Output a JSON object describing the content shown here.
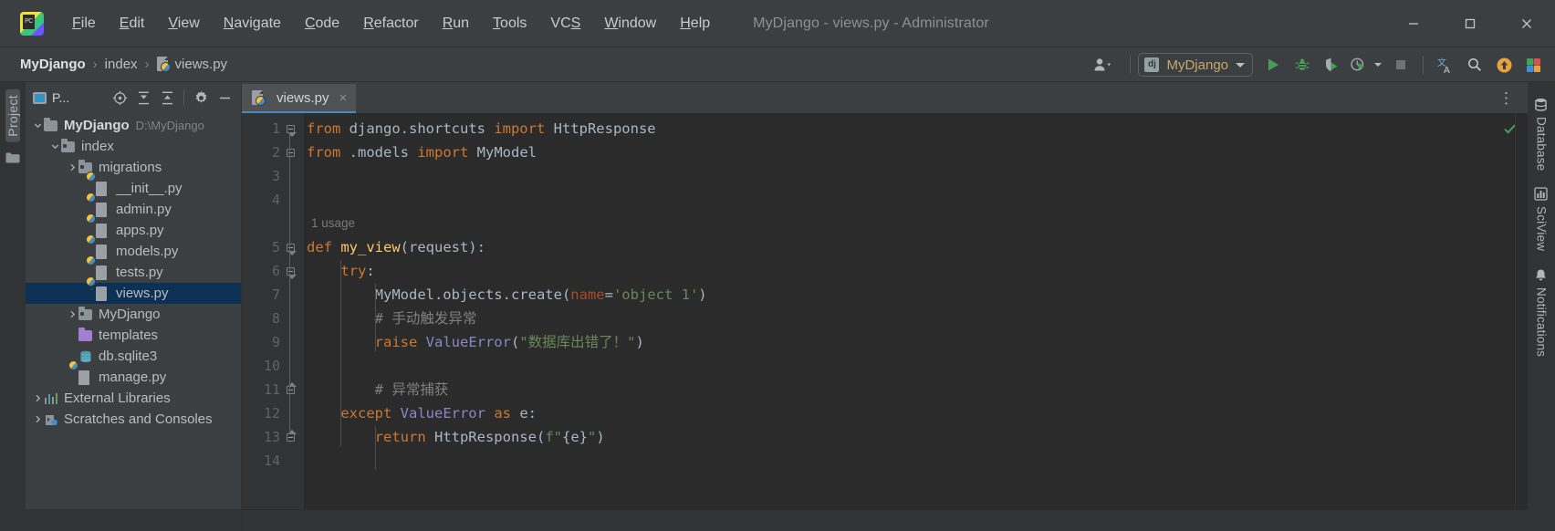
{
  "window": {
    "title": "MyDjango - views.py - Administrator",
    "logo_text": "PC",
    "minimize": "minimize-icon",
    "maximize": "maximize-icon",
    "close": "close-icon"
  },
  "menubar": [
    {
      "label": "File",
      "mnemonic": "F"
    },
    {
      "label": "Edit",
      "mnemonic": "E"
    },
    {
      "label": "View",
      "mnemonic": "V"
    },
    {
      "label": "Navigate",
      "mnemonic": "N"
    },
    {
      "label": "Code",
      "mnemonic": "C"
    },
    {
      "label": "Refactor",
      "mnemonic": "R"
    },
    {
      "label": "Run",
      "mnemonic": "R"
    },
    {
      "label": "Tools",
      "mnemonic": "T"
    },
    {
      "label": "VCS",
      "mnemonic": "S"
    },
    {
      "label": "Window",
      "mnemonic": "W"
    },
    {
      "label": "Help",
      "mnemonic": "H"
    }
  ],
  "breadcrumb": {
    "items": [
      "MyDjango",
      "index",
      "views.py"
    ],
    "separator": "›",
    "file_icon": "python-file-icon"
  },
  "toolbar": {
    "account_icon": "user-account-icon",
    "run_config": {
      "icon": "django-config-icon",
      "icon_text": "dj",
      "label": "MyDjango"
    },
    "run_icon": "run-icon",
    "debug_icon": "debug-icon",
    "coverage_icon": "run-with-coverage-icon",
    "profile_icon": "profiler-icon",
    "stop_icon": "stop-icon",
    "translate_icon": "translate-icon",
    "search_icon": "search-everywhere-icon",
    "update_icon": "update-available-icon",
    "plugin_icon": "plugin-icon"
  },
  "left_stripe": {
    "project_label": "Project",
    "structure_icon": "folder-icon"
  },
  "project_panel": {
    "title": "P...",
    "title_icon": "project-view-icon",
    "buttons": [
      {
        "name": "select-opened-file-button",
        "icon": "target-icon"
      },
      {
        "name": "expand-all-button",
        "icon": "expand-all-icon"
      },
      {
        "name": "collapse-all-button",
        "icon": "collapse-all-icon"
      },
      {
        "name": "settings-button",
        "icon": "gear-icon"
      },
      {
        "name": "hide-button",
        "icon": "minus-icon"
      }
    ],
    "tree": [
      {
        "label": "MyDjango",
        "path": "D:\\MyDjango",
        "indent": 0,
        "arrow": "down",
        "icon": "folder",
        "bold": true,
        "selected": false
      },
      {
        "label": "index",
        "path": "",
        "indent": 1,
        "arrow": "down",
        "icon": "folder-module",
        "bold": false,
        "selected": false
      },
      {
        "label": "migrations",
        "path": "",
        "indent": 2,
        "arrow": "right",
        "icon": "folder-module",
        "bold": false,
        "selected": false
      },
      {
        "label": "__init__.py",
        "path": "",
        "indent": 3,
        "arrow": "none",
        "icon": "python-file",
        "bold": false,
        "selected": false
      },
      {
        "label": "admin.py",
        "path": "",
        "indent": 3,
        "arrow": "none",
        "icon": "python-file",
        "bold": false,
        "selected": false
      },
      {
        "label": "apps.py",
        "path": "",
        "indent": 3,
        "arrow": "none",
        "icon": "python-file",
        "bold": false,
        "selected": false
      },
      {
        "label": "models.py",
        "path": "",
        "indent": 3,
        "arrow": "none",
        "icon": "python-file",
        "bold": false,
        "selected": false
      },
      {
        "label": "tests.py",
        "path": "",
        "indent": 3,
        "arrow": "none",
        "icon": "python-file",
        "bold": false,
        "selected": false
      },
      {
        "label": "views.py",
        "path": "",
        "indent": 3,
        "arrow": "none",
        "icon": "python-file",
        "bold": false,
        "selected": true
      },
      {
        "label": "MyDjango",
        "path": "",
        "indent": 2,
        "arrow": "right",
        "icon": "folder-module",
        "bold": false,
        "selected": false
      },
      {
        "label": "templates",
        "path": "",
        "indent": 2,
        "arrow": "none",
        "icon": "folder-purple",
        "bold": false,
        "selected": false
      },
      {
        "label": "db.sqlite3",
        "path": "",
        "indent": 2,
        "arrow": "none",
        "icon": "database",
        "bold": false,
        "selected": false
      },
      {
        "label": "manage.py",
        "path": "",
        "indent": 2,
        "arrow": "none",
        "icon": "python-file",
        "bold": false,
        "selected": false
      },
      {
        "label": "External Libraries",
        "path": "",
        "indent": 0,
        "arrow": "right",
        "icon": "library",
        "bold": false,
        "selected": false
      },
      {
        "label": "Scratches and Consoles",
        "path": "",
        "indent": 0,
        "arrow": "right",
        "icon": "scratch",
        "bold": false,
        "selected": false
      }
    ]
  },
  "editor": {
    "tab": {
      "label": "views.py",
      "icon": "python-file-icon",
      "close": "×"
    },
    "kebab": "⋮",
    "inspection_status": "ok-check-icon",
    "lines": [
      {
        "num": "1",
        "segments": [
          {
            "t": "from ",
            "c": "kw"
          },
          {
            "t": "django.shortcuts ",
            "c": "plain"
          },
          {
            "t": "import ",
            "c": "kw"
          },
          {
            "t": "HttpResponse",
            "c": "plain"
          }
        ]
      },
      {
        "num": "2",
        "segments": [
          {
            "t": "from ",
            "c": "kw"
          },
          {
            "t": ".models ",
            "c": "plain"
          },
          {
            "t": "import ",
            "c": "kw"
          },
          {
            "t": "MyModel",
            "c": "plain"
          }
        ]
      },
      {
        "num": "3",
        "segments": []
      },
      {
        "num": "4",
        "segments": []
      },
      {
        "num": "5",
        "segments": [
          {
            "t": "def ",
            "c": "kw"
          },
          {
            "t": "my_view",
            "c": "fn"
          },
          {
            "t": "(request):",
            "c": "plain"
          }
        ]
      },
      {
        "num": "6",
        "segments": [
          {
            "t": "    ",
            "c": "plain"
          },
          {
            "t": "try",
            "c": "kw"
          },
          {
            "t": ":",
            "c": "plain"
          }
        ]
      },
      {
        "num": "7",
        "segments": [
          {
            "t": "        MyModel.objects.create(",
            "c": "plain"
          },
          {
            "t": "name",
            "c": "prm"
          },
          {
            "t": "=",
            "c": "plain"
          },
          {
            "t": "'object 1'",
            "c": "str"
          },
          {
            "t": ")",
            "c": "plain"
          }
        ]
      },
      {
        "num": "8",
        "segments": [
          {
            "t": "        # 手动触发异常",
            "c": "cm"
          }
        ]
      },
      {
        "num": "9",
        "segments": [
          {
            "t": "        ",
            "c": "plain"
          },
          {
            "t": "raise ",
            "c": "kw"
          },
          {
            "t": "ValueError",
            "c": "bi"
          },
          {
            "t": "(",
            "c": "plain"
          },
          {
            "t": "\"数据库出错了！\"",
            "c": "str"
          },
          {
            "t": ")",
            "c": "plain"
          }
        ]
      },
      {
        "num": "10",
        "segments": []
      },
      {
        "num": "11",
        "segments": [
          {
            "t": "        # 异常捕获",
            "c": "cm"
          }
        ]
      },
      {
        "num": "12",
        "segments": [
          {
            "t": "    ",
            "c": "plain"
          },
          {
            "t": "except ",
            "c": "kw"
          },
          {
            "t": "ValueError ",
            "c": "bi"
          },
          {
            "t": "as ",
            "c": "kw"
          },
          {
            "t": "e:",
            "c": "plain"
          }
        ]
      },
      {
        "num": "13",
        "segments": [
          {
            "t": "        ",
            "c": "plain"
          },
          {
            "t": "return ",
            "c": "kw"
          },
          {
            "t": "HttpResponse(",
            "c": "plain"
          },
          {
            "t": "f\"",
            "c": "str"
          },
          {
            "t": "{e}",
            "c": "plain"
          },
          {
            "t": "\"",
            "c": "str"
          },
          {
            "t": ")",
            "c": "plain"
          }
        ]
      },
      {
        "num": "14",
        "segments": []
      }
    ],
    "inlay_hints": [
      {
        "text": "1 usage",
        "after_line": "4"
      }
    ]
  },
  "right_stripe": {
    "items": [
      {
        "label": "Database",
        "icon": "database-icon"
      },
      {
        "label": "SciView",
        "icon": "sciview-icon"
      },
      {
        "label": "Notifications",
        "icon": "notifications-bell-icon"
      }
    ]
  },
  "colors": {
    "accent_blue": "#4a88c7",
    "selection_blue": "#0d3055",
    "editor_bg": "#2b2b2b",
    "panel_bg": "#3c3f41",
    "stripe_bg": "#313335",
    "keyword_orange": "#cc7832",
    "string_green": "#6a8759",
    "function_yellow": "#ffc66d",
    "builtin_purple": "#8888c6",
    "comment_grey": "#808080",
    "param_red": "#aa4926",
    "run_green": "#499c54"
  }
}
